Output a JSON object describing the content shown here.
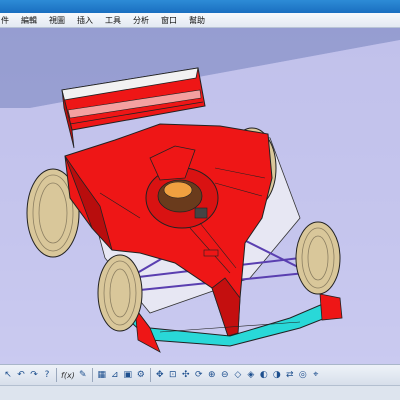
{
  "menu": {
    "items": [
      {
        "id": "file",
        "label": "件"
      },
      {
        "id": "edit",
        "label": "編輯"
      },
      {
        "id": "view",
        "label": "視圖"
      },
      {
        "id": "insert",
        "label": "插入"
      },
      {
        "id": "tools",
        "label": "工具"
      },
      {
        "id": "analyze",
        "label": "分析"
      },
      {
        "id": "window",
        "label": "窗口"
      },
      {
        "id": "help",
        "label": "幫助"
      }
    ]
  },
  "toolbar": {
    "formula_label": "f(x)",
    "icons": [
      "select-icon",
      "undo-icon",
      "redo-icon",
      "help-query-icon",
      "formula-icon",
      "comment-icon",
      "table-icon",
      "measure-icon",
      "save-icon",
      "parts-icon",
      "pan-icon",
      "fit-all-icon",
      "move-icon",
      "rotate-icon",
      "zoom-in-icon",
      "zoom-out-icon",
      "normal-view-icon",
      "isometric-view-icon",
      "shading-icon",
      "hide-show-icon",
      "swap-space-icon",
      "material-icon",
      "3d-compass-icon"
    ]
  },
  "model": {
    "name": "F1 race car assembly",
    "colors": {
      "body": "#ee1616",
      "body_shadow": "#b80d0d",
      "tire": "#d9c79a",
      "tire_tread": "#8c7f62",
      "front_wing": "#29d8d8",
      "suspension": "#5a3fb0",
      "edge": "#222222",
      "background": "#bdbde6",
      "floor": "#dcdcf0"
    }
  }
}
